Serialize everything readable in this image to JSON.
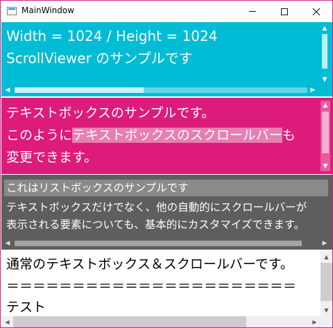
{
  "window": {
    "title": "MainWindow",
    "icons": {
      "app": "window-icon",
      "minimize": "minimize-icon",
      "maximize": "maximize-icon",
      "close": "close-icon"
    }
  },
  "panel1": {
    "line1": "Width = 1024 / Height = 1024",
    "line2": "ScrollViewer のサンプルです",
    "background": "#00bcd4",
    "vscroll_position": 0,
    "hscroll_position": 0
  },
  "panel2": {
    "line1": "テキストボックスのサンプルです。",
    "line2_pre": "このように",
    "line2_sel": "テキストボックスのスクロールバー",
    "line2_post": "も",
    "line3": "変更できます。",
    "background": "#dd1b7b",
    "selection_color": "#e87fb2"
  },
  "panel3": {
    "item1": "これはリストボックスのサンプルです",
    "item2": "テキストボックスだけでなく、他の自動的にスクロールバーが",
    "item3": "表示される要素についても、基本的にカスタマイズできます。",
    "background": "#5e5e5e",
    "selected_item_color": "#8a8a8a"
  },
  "panel4": {
    "line1": "通常のテキストボックス＆スクロールバーです。",
    "line2": "＝＝＝＝＝＝＝＝＝＝＝＝＝＝＝＝＝＝＝＝＝＝",
    "line3": "テスト",
    "background": "#ffffff"
  }
}
